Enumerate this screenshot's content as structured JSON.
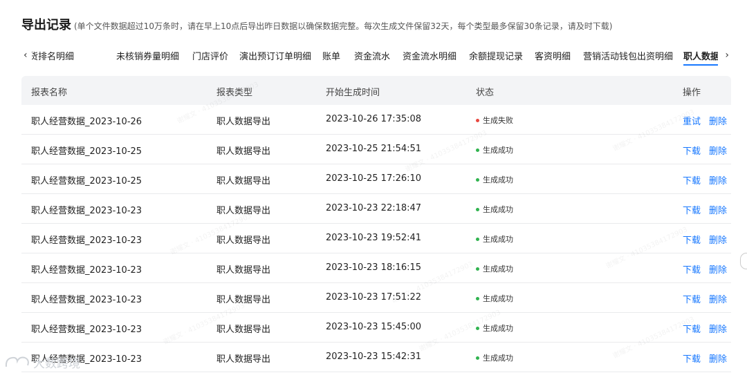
{
  "header": {
    "title": "导出记录",
    "note": "(单个文件数据超过10万条时，请在早上10点后导出昨日数据以确保数据完整。每次生成文件保留32天，每个类型最多保留30条记录，请及时下载)"
  },
  "tabs": {
    "prev_icon": "chevron-left-icon",
    "next_icon": "chevron-right-icon",
    "items": [
      "热货排名明细",
      "未核销券量明细",
      "门店评价",
      "演出预订订单明细",
      "账单",
      "资金流水",
      "资金流水明细",
      "余额提现记录",
      "客资明细",
      "营销活动钱包出资明细",
      "职人数据导出"
    ],
    "first_partial": "货排名明细",
    "active": "职人数据导出"
  },
  "table": {
    "columns": [
      "报表名称",
      "报表类型",
      "开始生成时间",
      "状态",
      "操作"
    ],
    "rows": [
      {
        "name": "职人经营数据_2023-10-26",
        "type": "职人数据导出",
        "time": "2023-10-26 17:35:08",
        "status": "生成失败",
        "status_color": "#e8473f",
        "action1": "重试",
        "action2": "删除"
      },
      {
        "name": "职人经营数据_2023-10-25",
        "type": "职人数据导出",
        "time": "2023-10-25 21:54:51",
        "status": "生成成功",
        "status_color": "#30b34f",
        "action1": "下载",
        "action2": "删除"
      },
      {
        "name": "职人经营数据_2023-10-25",
        "type": "职人数据导出",
        "time": "2023-10-25 17:26:10",
        "status": "生成成功",
        "status_color": "#30b34f",
        "action1": "下载",
        "action2": "删除"
      },
      {
        "name": "职人经营数据_2023-10-23",
        "type": "职人数据导出",
        "time": "2023-10-23 22:18:47",
        "status": "生成成功",
        "status_color": "#30b34f",
        "action1": "下载",
        "action2": "删除"
      },
      {
        "name": "职人经营数据_2023-10-23",
        "type": "职人数据导出",
        "time": "2023-10-23 19:52:41",
        "status": "生成成功",
        "status_color": "#30b34f",
        "action1": "下载",
        "action2": "删除"
      },
      {
        "name": "职人经营数据_2023-10-23",
        "type": "职人数据导出",
        "time": "2023-10-23 18:16:15",
        "status": "生成成功",
        "status_color": "#30b34f",
        "action1": "下载",
        "action2": "删除"
      },
      {
        "name": "职人经营数据_2023-10-23",
        "type": "职人数据导出",
        "time": "2023-10-23 17:51:22",
        "status": "生成成功",
        "status_color": "#30b34f",
        "action1": "下载",
        "action2": "删除"
      },
      {
        "name": "职人经营数据_2023-10-23",
        "type": "职人数据导出",
        "time": "2023-10-23 15:45:00",
        "status": "生成成功",
        "status_color": "#30b34f",
        "action1": "下载",
        "action2": "删除"
      },
      {
        "name": "职人经营数据_2023-10-23",
        "type": "职人数据导出",
        "time": "2023-10-23 15:42:31",
        "status": "生成成功",
        "status_color": "#30b34f",
        "action1": "下载",
        "action2": "删除"
      }
    ]
  },
  "watermark": {
    "brand": "大数跨境",
    "tile": "谢耀文 · 41035384172903"
  },
  "colors": {
    "link": "#1677ff",
    "header_bg": "#f3f4f6",
    "success": "#30b34f",
    "fail": "#e8473f"
  }
}
